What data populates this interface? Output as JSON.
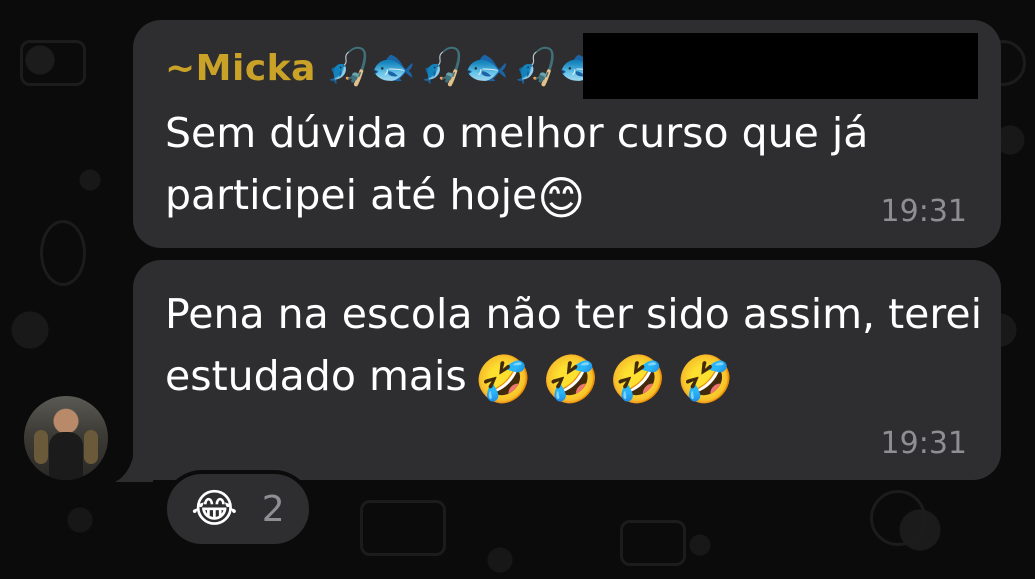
{
  "messages": [
    {
      "sender": "~Micka",
      "sender_emojis": [
        "🎣🐟",
        "🎣🐟",
        "🎣🐟"
      ],
      "text": "Sem dúvida o melhor curso que já participei até hoje",
      "emoji": "😊",
      "time": "19:31"
    },
    {
      "text": "Pena na escola não ter sido assim, terei estudado mais",
      "emojis": [
        "🤣",
        "🤣",
        "🤣",
        "🤣"
      ],
      "time": "19:31"
    }
  ],
  "reaction": {
    "emoji": "😂",
    "count": "2"
  },
  "colors": {
    "background": "#0b0b0b",
    "bubble": "#2e2e30",
    "sender_name": "#c9a227",
    "timestamp": "#8e8e93"
  }
}
